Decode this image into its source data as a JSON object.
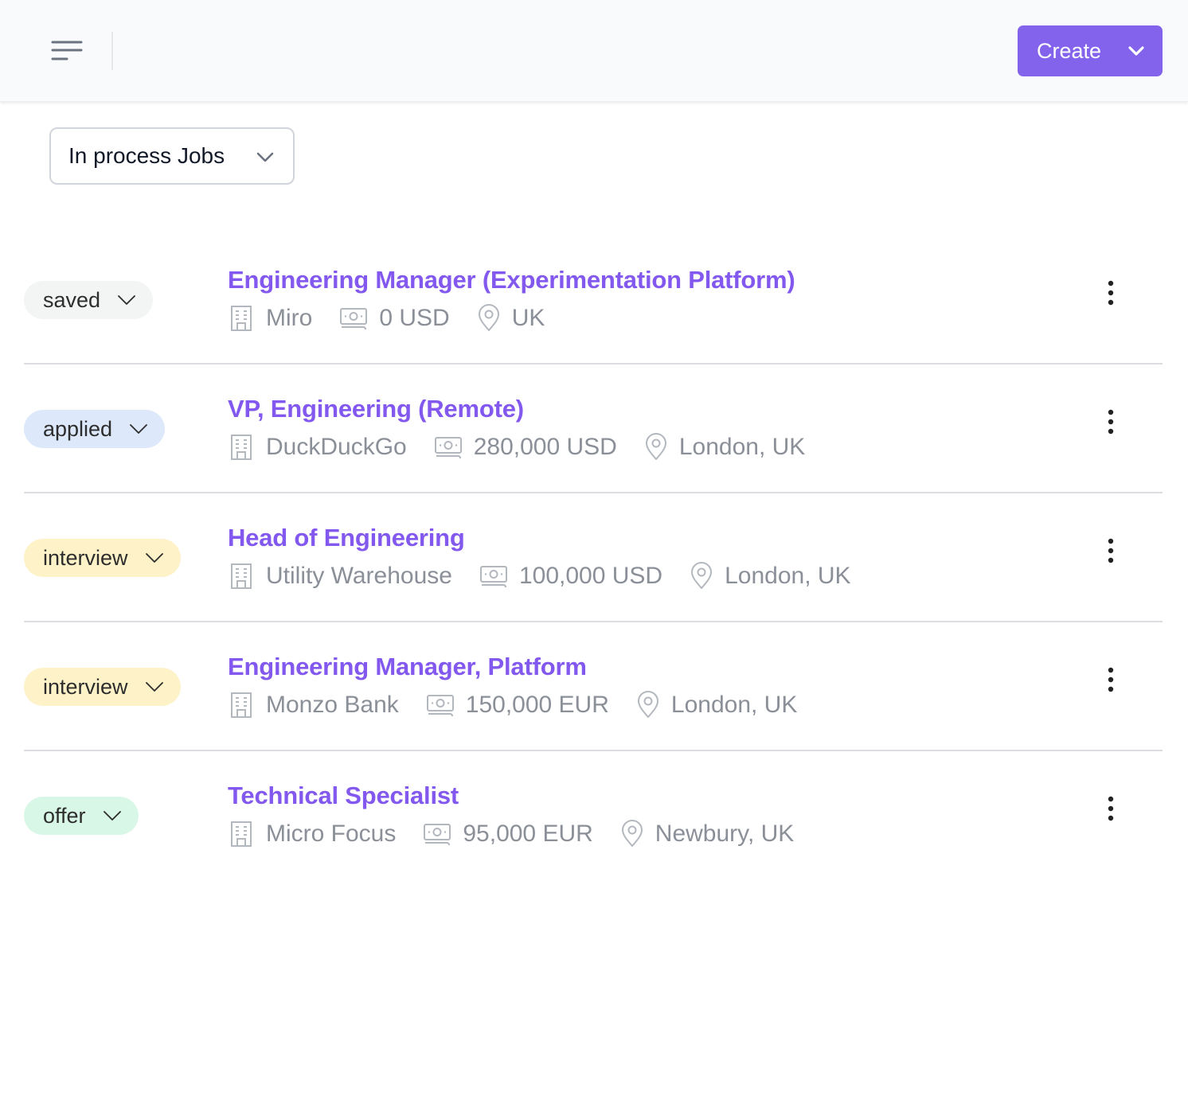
{
  "topbar": {
    "menu_icon": "menu-icon",
    "create_button_label": "Create",
    "create_icon": "chevron-down-icon",
    "accent_color": "#8363ec"
  },
  "filter": {
    "selected": "In process Jobs",
    "icon": "chevron-down-icon"
  },
  "jobs": [
    {
      "status": "saved",
      "status_color": "#f3f4f4",
      "title": "Engineering Manager (Experimentation Platform)",
      "company": "Miro",
      "salary": "0 USD",
      "location": "UK"
    },
    {
      "status": "applied",
      "status_color": "#dde8fb",
      "title": "VP, Engineering (Remote)",
      "company": "DuckDuckGo",
      "salary": "280,000 USD",
      "location": "London, UK"
    },
    {
      "status": "interview",
      "status_color": "#fdf2c8",
      "title": "Head of Engineering",
      "company": "Utility Warehouse",
      "salary": "100,000 USD",
      "location": "London, UK"
    },
    {
      "status": "interview",
      "status_color": "#fdf2c8",
      "title": "Engineering Manager, Platform",
      "company": "Monzo Bank",
      "salary": "150,000 EUR",
      "location": "London, UK"
    },
    {
      "status": "offer",
      "status_color": "#d9f7e6",
      "title": "Technical Specialist",
      "company": "Micro Focus",
      "salary": "95,000 EUR",
      "location": "Newbury, UK"
    }
  ],
  "title_color": "#8258ee"
}
